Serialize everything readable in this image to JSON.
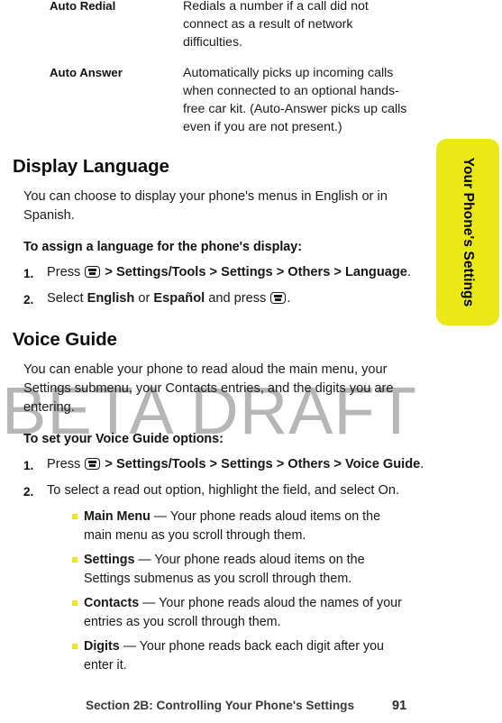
{
  "watermark": "BETA DRAFT",
  "side_tab": {
    "label": "Your Phone's Settings",
    "color": "#eae817"
  },
  "settings_table": {
    "rows": [
      {
        "name": "Auto Redial",
        "description": "Redials a number if a call did not connect as a result of network difficulties."
      },
      {
        "name": "Auto Answer",
        "description": "Automatically picks up incoming calls when connected to an optional hands-free car kit. (Auto-Answer picks up calls even if you are not present.)"
      }
    ]
  },
  "display_language": {
    "heading": "Display Language",
    "intro": "You can choose to display your phone's menus in English or in Spanish.",
    "lead_in": "To assign a language for the phone's display:",
    "steps": [
      {
        "num": "1.",
        "pre": "Press",
        "icon": "menu-ok-key-icon",
        "path": " > Settings/Tools > Settings > Others > Language",
        "post": "."
      },
      {
        "num": "2.",
        "pre": "Select ",
        "opt1": "English",
        "mid": " or ",
        "opt2": "Español",
        "post": " and press ",
        "icon": "menu-ok-key-icon",
        "end": "."
      }
    ]
  },
  "voice_guide": {
    "heading": "Voice Guide",
    "intro": "You can enable your phone to read aloud the main menu, your Settings submenu, your Contacts entries, and the digits you are entering.",
    "lead_in": "To set your Voice Guide options:",
    "step1": {
      "num": "1.",
      "pre": "Press",
      "icon": "menu-ok-key-icon",
      "path": " > Settings/Tools > Settings > Others > Voice Guide",
      "post": "."
    },
    "step2": {
      "num": "2.",
      "text": "To select a read out option, highlight the field, and select On."
    },
    "bullets": [
      {
        "term": "Main Menu",
        "dash": " — ",
        "desc": "Your phone reads aloud items on the main menu as you scroll through them."
      },
      {
        "term": "Settings",
        "dash": " — ",
        "desc": "Your phone reads aloud items on the Settings submenus as you scroll through them."
      },
      {
        "term": "Contacts",
        "dash": " — ",
        "desc": "Your phone reads aloud the names of your entries as you scroll through them."
      },
      {
        "term": "Digits",
        "dash": " — ",
        "desc": "Your phone reads back each digit after you enter it."
      }
    ]
  },
  "footer": {
    "section_title": "Section 2B: Controlling Your Phone's Settings",
    "page_number": "91"
  }
}
